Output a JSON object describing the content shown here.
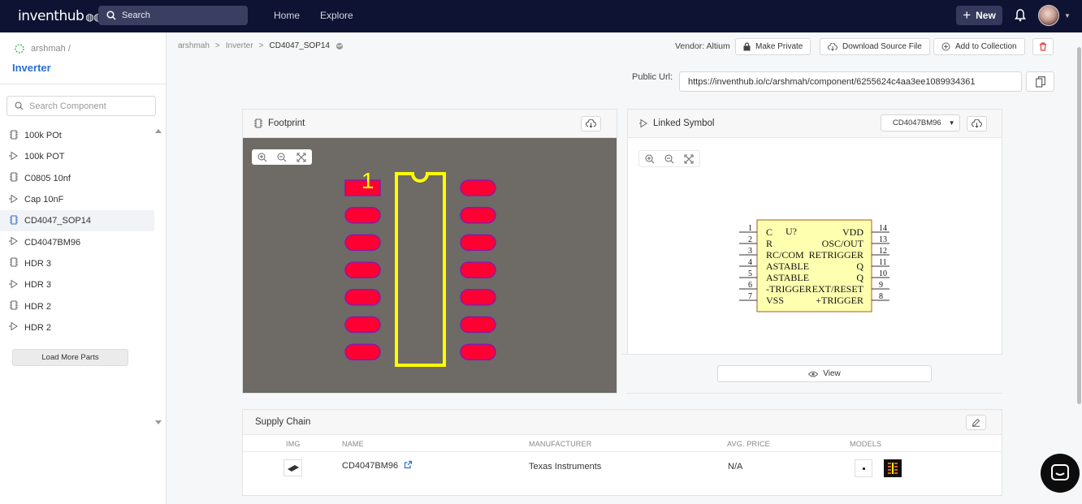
{
  "topbar": {
    "logo_text": "inventhub",
    "search_label": "Search",
    "nav_home": "Home",
    "nav_explore": "Explore",
    "new_label": "New"
  },
  "sidebar": {
    "owner": "arshmah /",
    "project": "Inverter",
    "search_placeholder": "Search Component",
    "items": [
      {
        "label": "100k POt",
        "icon": "footprint-icon"
      },
      {
        "label": "100k POT",
        "icon": "symbol-icon"
      },
      {
        "label": "C0805 10nf",
        "icon": "footprint-icon"
      },
      {
        "label": "Cap 10nF",
        "icon": "symbol-icon"
      },
      {
        "label": "CD4047_SOP14",
        "icon": "footprint-icon",
        "active": true
      },
      {
        "label": "CD4047BM96",
        "icon": "symbol-icon"
      },
      {
        "label": "HDR 3",
        "icon": "footprint-icon"
      },
      {
        "label": "HDR 3",
        "icon": "symbol-icon"
      },
      {
        "label": "HDR 2",
        "icon": "footprint-icon"
      },
      {
        "label": "HDR 2",
        "icon": "symbol-icon"
      }
    ],
    "load_more": "Load More Parts"
  },
  "breadcrumb": {
    "owner": "arshmah",
    "sep": ">",
    "project": "Inverter",
    "current": "CD4047_SOP14"
  },
  "toolbar": {
    "vendor": "Vendor: Altium",
    "make_private": "Make Private",
    "download_source": "Download Source File",
    "add_collection": "Add to Collection"
  },
  "public_url": {
    "label": "Public Url:",
    "value": "https://inventhub.io/c/arshmah/component/6255624c4aa3ee1089934361"
  },
  "footprint": {
    "title": "Footprint",
    "pin1_label": "1",
    "pads_per_side": 7
  },
  "symbol": {
    "title": "Linked Symbol",
    "selected": "CD4047BM96",
    "view_label": "View",
    "left_pins": [
      {
        "num": "1",
        "name": "C"
      },
      {
        "num": "2",
        "name": "R"
      },
      {
        "num": "3",
        "name": "RC/COM"
      },
      {
        "num": "4",
        "name": "ASTABLE"
      },
      {
        "num": "5",
        "name": "ASTABLE"
      },
      {
        "num": "6",
        "name": "-TRIGGER"
      },
      {
        "num": "7",
        "name": "VSS"
      }
    ],
    "right_pins": [
      {
        "num": "14",
        "name": "VDD"
      },
      {
        "num": "13",
        "name": "OSC/OUT"
      },
      {
        "num": "12",
        "name": "RETRIGGER"
      },
      {
        "num": "11",
        "name": "Q"
      },
      {
        "num": "10",
        "name": "Q"
      },
      {
        "num": "9",
        "name": "EXT/RESET"
      },
      {
        "num": "8",
        "name": "+TRIGGER"
      }
    ],
    "designator": "U?"
  },
  "supply_chain": {
    "title": "Supply Chain",
    "headers": {
      "img": "IMG",
      "name": "NAME",
      "manufacturer": "MANUFACTURER",
      "price": "AVG. PRICE",
      "models": "MODELS"
    },
    "row": {
      "name": "CD4047BM96",
      "manufacturer": "Texas Instruments",
      "price": "N/A"
    }
  },
  "colors": {
    "topbar_bg": "#0e1333",
    "accent_blue": "#2a6fd6",
    "pad_red": "#ff0033",
    "silkscreen_yellow": "#ffff00",
    "pcb_bg": "#6e6a66",
    "symbol_body": "#ffffb0",
    "delete_red": "#e53935"
  }
}
